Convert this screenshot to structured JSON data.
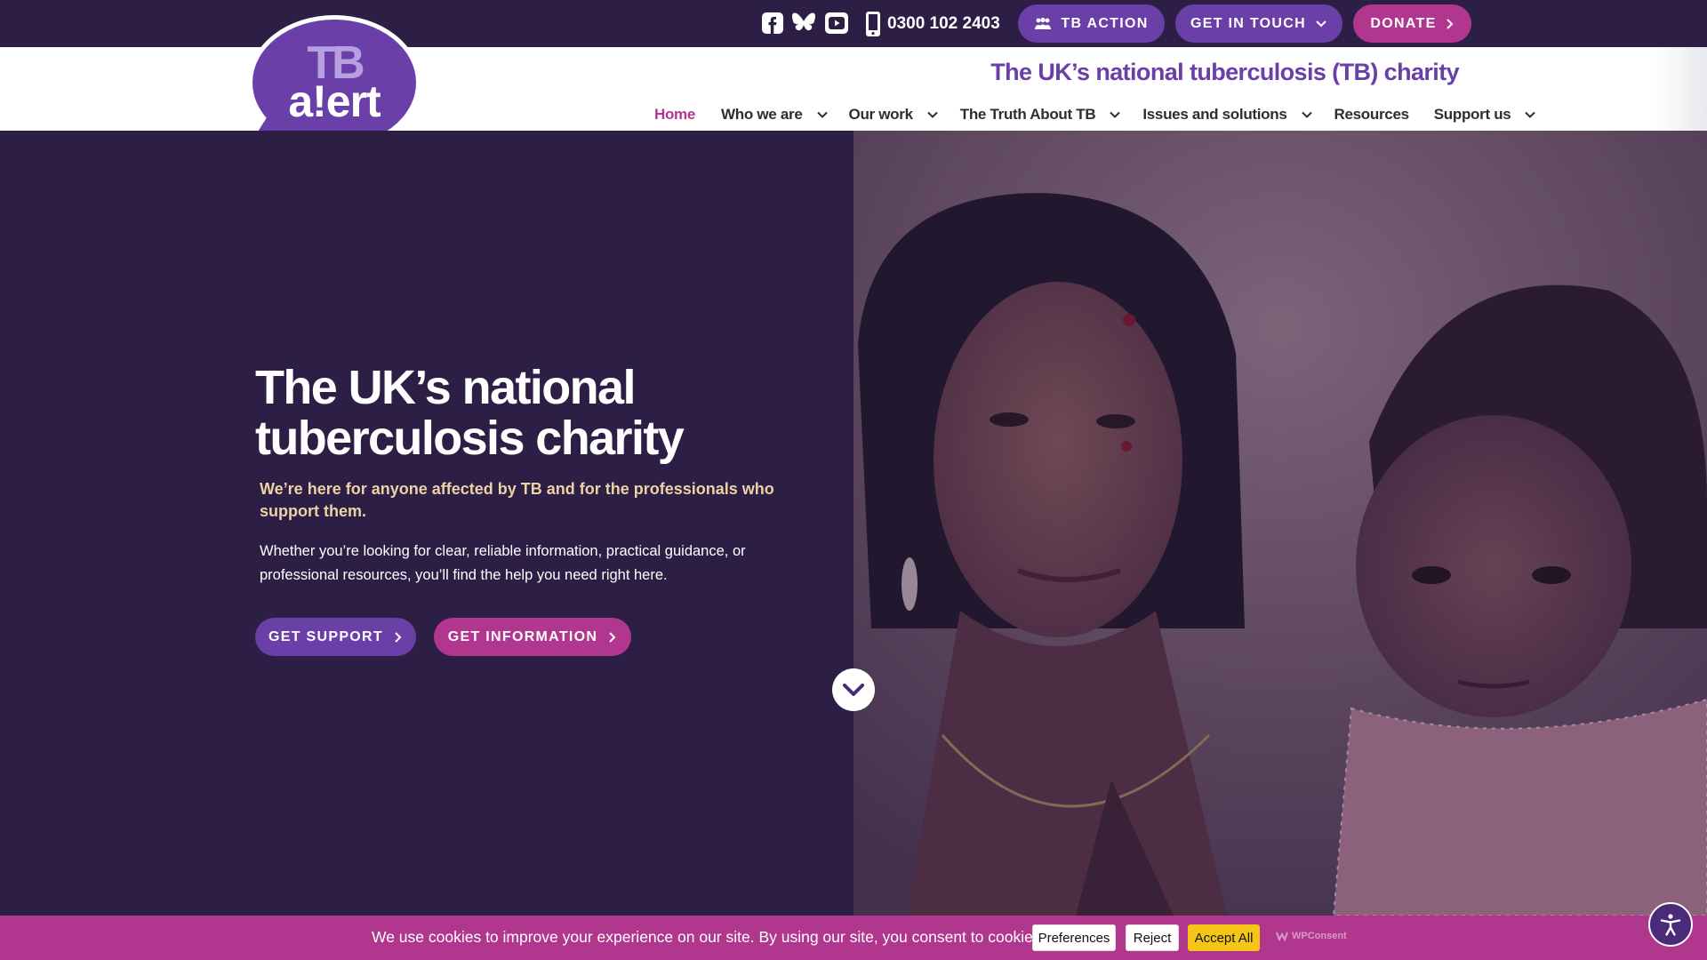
{
  "topbar": {
    "social": [
      "facebook-icon",
      "bluesky-icon",
      "youtube-icon"
    ],
    "phone": "0300 102 2403",
    "tb_action": "TB ACTION",
    "get_in_touch": "GET IN TOUCH",
    "donate": "DONATE"
  },
  "logo": {
    "line1": "TB",
    "line2": "a!ert"
  },
  "header": {
    "tagline": "The UK’s national tuberculosis (TB) charity",
    "nav": [
      {
        "label": "Home",
        "active": true,
        "has_dropdown": false
      },
      {
        "label": "Who we are",
        "has_dropdown": true
      },
      {
        "label": "Our work",
        "has_dropdown": true
      },
      {
        "label": "The Truth About TB",
        "has_dropdown": true
      },
      {
        "label": "Issues and solutions",
        "has_dropdown": true
      },
      {
        "label": "Resources",
        "has_dropdown": false
      },
      {
        "label": "Support us",
        "has_dropdown": true
      }
    ]
  },
  "hero": {
    "title": "The UK’s national tuberculosis charity",
    "subtitle": "We’re here for anyone affected by TB and for the professionals who support them.",
    "body": "Whether you’re looking for clear, reliable information, practical guidance, or professional resources, you’ll find the help you need right here.",
    "cta_support": "GET SUPPORT",
    "cta_information": "GET INFORMATION"
  },
  "cookie": {
    "text": "We use cookies to improve your experience on our site. By using our site, you consent to cookies.",
    "preferences": "Preferences",
    "reject": "Reject",
    "accept_all": "Accept All",
    "brand": "WPConsent"
  },
  "colors": {
    "dark_purple": "#2c1e44",
    "purple": "#6a40a8",
    "magenta": "#b1378e",
    "accept_yellow": "#f5c518",
    "subtitle_tan": "#ecd2a4"
  }
}
